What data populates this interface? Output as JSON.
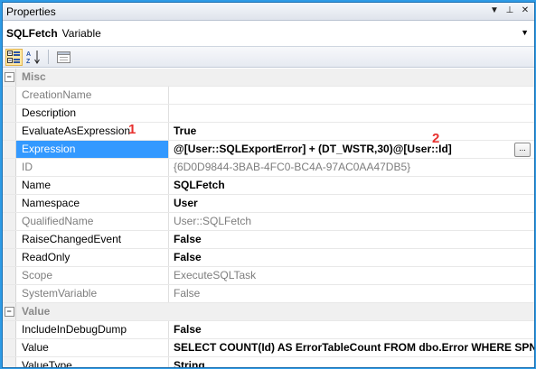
{
  "window": {
    "title": "Properties"
  },
  "title_buttons": {
    "dropdown": "▼",
    "pin": "⊥",
    "close": "✕"
  },
  "object_selector": {
    "name": "SQLFetch",
    "type": "Variable"
  },
  "categories": {
    "misc": "Misc",
    "value": "Value"
  },
  "misc_props": [
    {
      "name": "CreationName",
      "value": ""
    },
    {
      "name": "Description",
      "value": ""
    },
    {
      "name": "EvaluateAsExpression",
      "value": "True"
    },
    {
      "name": "Expression",
      "value": "@[User::SQLExportError] + (DT_WSTR,30)@[User::Id]"
    },
    {
      "name": "ID",
      "value": "{6D0D9844-3BAB-4FC0-BC4A-97AC0AA47DB5}"
    },
    {
      "name": "Name",
      "value": "SQLFetch"
    },
    {
      "name": "Namespace",
      "value": "User"
    },
    {
      "name": "QualifiedName",
      "value": "User::SQLFetch"
    },
    {
      "name": "RaiseChangedEvent",
      "value": "False"
    },
    {
      "name": "ReadOnly",
      "value": "False"
    },
    {
      "name": "Scope",
      "value": "ExecuteSQLTask"
    },
    {
      "name": "SystemVariable",
      "value": "False"
    }
  ],
  "value_props": [
    {
      "name": "IncludeInDebugDump",
      "value": "False"
    },
    {
      "name": "Value",
      "value": "SELECT COUNT(Id) AS ErrorTableCount FROM dbo.Error WHERE SPName i"
    },
    {
      "name": "ValueType",
      "value": "String"
    }
  ],
  "annotations": {
    "one": "1",
    "two": "2"
  },
  "ellipsis_label": "...",
  "colors": {
    "selection": "#3399ff",
    "annotation": "#e8312f",
    "frame": "#2e9be6"
  }
}
